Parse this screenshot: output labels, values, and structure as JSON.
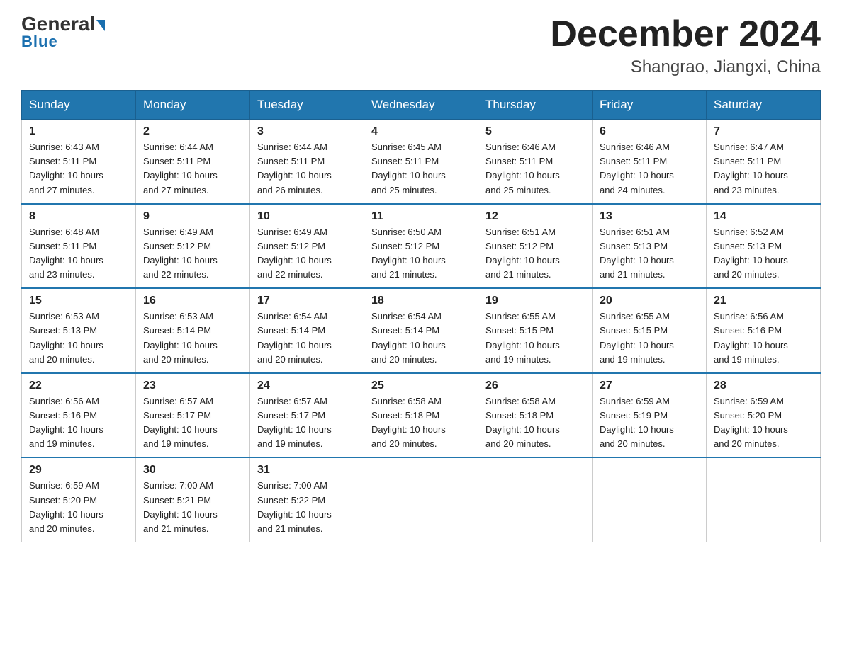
{
  "header": {
    "logo_general": "General",
    "logo_blue": "Blue",
    "title": "December 2024",
    "subtitle": "Shangrao, Jiangxi, China"
  },
  "weekdays": [
    "Sunday",
    "Monday",
    "Tuesday",
    "Wednesday",
    "Thursday",
    "Friday",
    "Saturday"
  ],
  "weeks": [
    [
      {
        "day": "1",
        "sunrise": "6:43 AM",
        "sunset": "5:11 PM",
        "daylight": "10 hours and 27 minutes."
      },
      {
        "day": "2",
        "sunrise": "6:44 AM",
        "sunset": "5:11 PM",
        "daylight": "10 hours and 27 minutes."
      },
      {
        "day": "3",
        "sunrise": "6:44 AM",
        "sunset": "5:11 PM",
        "daylight": "10 hours and 26 minutes."
      },
      {
        "day": "4",
        "sunrise": "6:45 AM",
        "sunset": "5:11 PM",
        "daylight": "10 hours and 25 minutes."
      },
      {
        "day": "5",
        "sunrise": "6:46 AM",
        "sunset": "5:11 PM",
        "daylight": "10 hours and 25 minutes."
      },
      {
        "day": "6",
        "sunrise": "6:46 AM",
        "sunset": "5:11 PM",
        "daylight": "10 hours and 24 minutes."
      },
      {
        "day": "7",
        "sunrise": "6:47 AM",
        "sunset": "5:11 PM",
        "daylight": "10 hours and 23 minutes."
      }
    ],
    [
      {
        "day": "8",
        "sunrise": "6:48 AM",
        "sunset": "5:11 PM",
        "daylight": "10 hours and 23 minutes."
      },
      {
        "day": "9",
        "sunrise": "6:49 AM",
        "sunset": "5:12 PM",
        "daylight": "10 hours and 22 minutes."
      },
      {
        "day": "10",
        "sunrise": "6:49 AM",
        "sunset": "5:12 PM",
        "daylight": "10 hours and 22 minutes."
      },
      {
        "day": "11",
        "sunrise": "6:50 AM",
        "sunset": "5:12 PM",
        "daylight": "10 hours and 21 minutes."
      },
      {
        "day": "12",
        "sunrise": "6:51 AM",
        "sunset": "5:12 PM",
        "daylight": "10 hours and 21 minutes."
      },
      {
        "day": "13",
        "sunrise": "6:51 AM",
        "sunset": "5:13 PM",
        "daylight": "10 hours and 21 minutes."
      },
      {
        "day": "14",
        "sunrise": "6:52 AM",
        "sunset": "5:13 PM",
        "daylight": "10 hours and 20 minutes."
      }
    ],
    [
      {
        "day": "15",
        "sunrise": "6:53 AM",
        "sunset": "5:13 PM",
        "daylight": "10 hours and 20 minutes."
      },
      {
        "day": "16",
        "sunrise": "6:53 AM",
        "sunset": "5:14 PM",
        "daylight": "10 hours and 20 minutes."
      },
      {
        "day": "17",
        "sunrise": "6:54 AM",
        "sunset": "5:14 PM",
        "daylight": "10 hours and 20 minutes."
      },
      {
        "day": "18",
        "sunrise": "6:54 AM",
        "sunset": "5:14 PM",
        "daylight": "10 hours and 20 minutes."
      },
      {
        "day": "19",
        "sunrise": "6:55 AM",
        "sunset": "5:15 PM",
        "daylight": "10 hours and 19 minutes."
      },
      {
        "day": "20",
        "sunrise": "6:55 AM",
        "sunset": "5:15 PM",
        "daylight": "10 hours and 19 minutes."
      },
      {
        "day": "21",
        "sunrise": "6:56 AM",
        "sunset": "5:16 PM",
        "daylight": "10 hours and 19 minutes."
      }
    ],
    [
      {
        "day": "22",
        "sunrise": "6:56 AM",
        "sunset": "5:16 PM",
        "daylight": "10 hours and 19 minutes."
      },
      {
        "day": "23",
        "sunrise": "6:57 AM",
        "sunset": "5:17 PM",
        "daylight": "10 hours and 19 minutes."
      },
      {
        "day": "24",
        "sunrise": "6:57 AM",
        "sunset": "5:17 PM",
        "daylight": "10 hours and 19 minutes."
      },
      {
        "day": "25",
        "sunrise": "6:58 AM",
        "sunset": "5:18 PM",
        "daylight": "10 hours and 20 minutes."
      },
      {
        "day": "26",
        "sunrise": "6:58 AM",
        "sunset": "5:18 PM",
        "daylight": "10 hours and 20 minutes."
      },
      {
        "day": "27",
        "sunrise": "6:59 AM",
        "sunset": "5:19 PM",
        "daylight": "10 hours and 20 minutes."
      },
      {
        "day": "28",
        "sunrise": "6:59 AM",
        "sunset": "5:20 PM",
        "daylight": "10 hours and 20 minutes."
      }
    ],
    [
      {
        "day": "29",
        "sunrise": "6:59 AM",
        "sunset": "5:20 PM",
        "daylight": "10 hours and 20 minutes."
      },
      {
        "day": "30",
        "sunrise": "7:00 AM",
        "sunset": "5:21 PM",
        "daylight": "10 hours and 21 minutes."
      },
      {
        "day": "31",
        "sunrise": "7:00 AM",
        "sunset": "5:22 PM",
        "daylight": "10 hours and 21 minutes."
      },
      null,
      null,
      null,
      null
    ]
  ],
  "labels": {
    "sunrise": "Sunrise:",
    "sunset": "Sunset:",
    "daylight": "Daylight:"
  }
}
